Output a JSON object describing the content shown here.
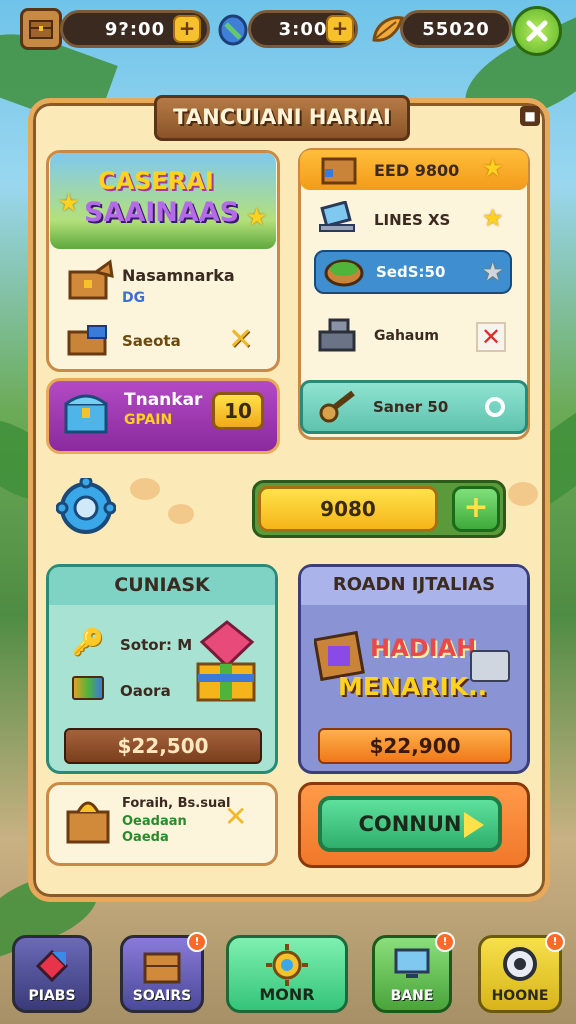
{
  "top_bar": {
    "resource1": "9?:00",
    "resource2": "3:00",
    "resource3": "55020"
  },
  "panel": {
    "title": "TANCUIANI HARIAI",
    "banner_line1": "CASERAI",
    "banner_line2": "SAAINAAS",
    "left_item1_title": "Nasamnarka",
    "left_item1_sub": "DG",
    "left_item2_title": "Saeota",
    "purple_title": "Tnankar",
    "purple_sub": "GPAIN",
    "purple_badge": "10",
    "right_rows": [
      "EED 9800",
      "LINES XS",
      "SedS:50",
      "Gahaum",
      "Saner 50"
    ],
    "progress_value": "9080",
    "teal_card": {
      "title": "CUNIASK",
      "item1": "Sotor: M",
      "item2": "Oaora",
      "price": "$22,500"
    },
    "blue_card": {
      "title": "ROADN IJTALIAS",
      "promo_line1": "HADIAH",
      "promo_line2": "MENARIK..",
      "price": "$22,900"
    },
    "small_card": {
      "line1": "Foraih, Bs.sual",
      "line2": "Oeadaan",
      "line3": "Oaeda"
    },
    "continue_button": "CONNUN"
  },
  "bottom_nav": [
    "PIABS",
    "SOAIRS",
    "MONR",
    "BANE",
    "HOONE"
  ],
  "colors": {
    "panel_bg": "#fbe9b8",
    "panel_border": "#e9a95a",
    "accent_green": "#2fae6b",
    "accent_yellow": "#f6c12a",
    "purple": "#9b2fb0",
    "teal": "#7fd3c4",
    "blue": "#7a86c9"
  }
}
